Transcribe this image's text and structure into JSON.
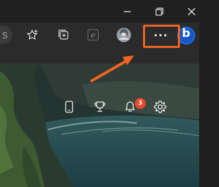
{
  "window": {
    "controls": [
      {
        "name": "minimize",
        "icon": "minimize-icon"
      },
      {
        "name": "restore",
        "icon": "restore-icon"
      },
      {
        "name": "close",
        "icon": "close-icon"
      }
    ]
  },
  "toolbar": {
    "address_fragment": "s",
    "buttons": [
      {
        "name": "favorites",
        "icon": "star-add-icon"
      },
      {
        "name": "collections",
        "icon": "collections-icon"
      },
      {
        "name": "internet-explorer-mode",
        "icon": "ie-mode-icon"
      },
      {
        "name": "profile",
        "icon": "avatar-icon"
      },
      {
        "name": "settings-and-more",
        "icon": "more-dots-icon",
        "label": "···",
        "highlighted": true
      },
      {
        "name": "bing",
        "icon": "bing-logo-icon",
        "label": "b"
      }
    ]
  },
  "content": {
    "icons": [
      {
        "name": "phone",
        "icon": "phone-icon"
      },
      {
        "name": "rewards",
        "icon": "trophy-icon"
      },
      {
        "name": "notifications",
        "icon": "bell-icon",
        "badge": "3"
      },
      {
        "name": "settings",
        "icon": "gear-icon"
      }
    ]
  },
  "annotation": {
    "arrow_color": "#f26522",
    "highlight_color": "#f26522"
  },
  "colors": {
    "titlebar": "#202020",
    "toolbar": "#2b2b2b",
    "bing_blue": "#1a73e8",
    "badge": "#e8472b"
  }
}
